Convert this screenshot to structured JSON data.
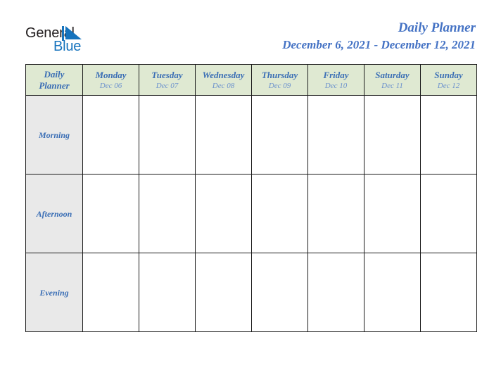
{
  "logo": {
    "word_top": "General",
    "word_bottom": "Blue",
    "mark": "triangle-mark",
    "color_text": "#231f20",
    "color_accent": "#1673bd"
  },
  "header": {
    "title": "Daily Planner",
    "date_range": "December 6, 2021 - December 12, 2021",
    "title_color": "#4472c4"
  },
  "table": {
    "corner_label_line1": "Daily",
    "corner_label_line2": "Planner",
    "header_bg": "#dfe9d2",
    "label_bg": "#e9e9e9",
    "border_color": "#1a1a1a",
    "columns": [
      {
        "day": "Monday",
        "date": "Dec 06"
      },
      {
        "day": "Tuesday",
        "date": "Dec 07"
      },
      {
        "day": "Wednesday",
        "date": "Dec 08"
      },
      {
        "day": "Thursday",
        "date": "Dec 09"
      },
      {
        "day": "Friday",
        "date": "Dec 10"
      },
      {
        "day": "Saturday",
        "date": "Dec 11"
      },
      {
        "day": "Sunday",
        "date": "Dec 12"
      }
    ],
    "rows": [
      {
        "label": "Morning",
        "cells": [
          "",
          "",
          "",
          "",
          "",
          "",
          ""
        ]
      },
      {
        "label": "Afternoon",
        "cells": [
          "",
          "",
          "",
          "",
          "",
          "",
          ""
        ]
      },
      {
        "label": "Evening",
        "cells": [
          "",
          "",
          "",
          "",
          "",
          "",
          ""
        ]
      }
    ]
  }
}
